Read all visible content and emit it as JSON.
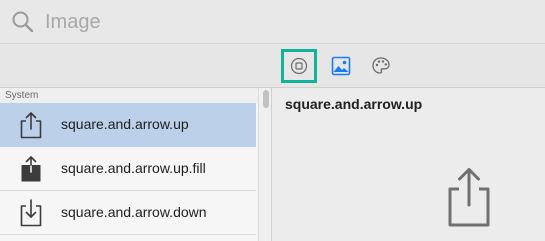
{
  "search": {
    "placeholder": "Image",
    "icon": "search-icon"
  },
  "toolbar": {
    "buttons": [
      {
        "icon": "stop-circle-icon",
        "selected": true
      },
      {
        "icon": "photo-icon",
        "selected": false,
        "color": "#1a7cf5"
      },
      {
        "icon": "palette-icon",
        "selected": false
      }
    ],
    "selection_color": "#11b39a"
  },
  "sidebar": {
    "section": "System",
    "items": [
      {
        "label": "square.and.arrow.up",
        "icon": "share-icon",
        "selected": true
      },
      {
        "label": "square.and.arrow.up.fill",
        "icon": "share-fill-icon",
        "selected": false
      },
      {
        "label": "square.and.arrow.down",
        "icon": "download-icon",
        "selected": false
      }
    ]
  },
  "detail": {
    "title": "square.and.arrow.up",
    "icon": "share-icon"
  }
}
